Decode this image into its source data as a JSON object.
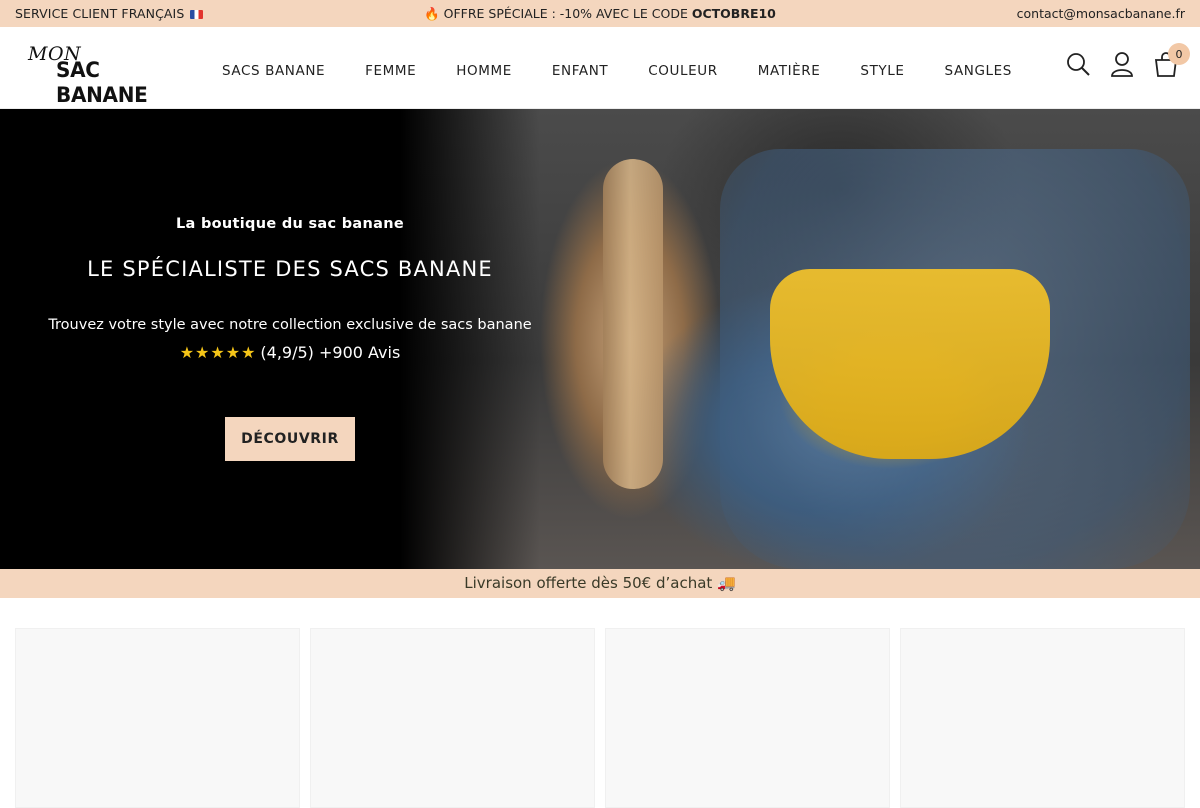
{
  "topbar": {
    "left_text": "SERVICE CLIENT FRANÇAIS",
    "flag_icon": "france-flag-icon",
    "offer_prefix": "🔥 OFFRE SPÉCIALE : -10% AVEC LE CODE ",
    "offer_code": "OCTOBRE10",
    "email": "contact@monsacbanane.fr"
  },
  "logo": {
    "top": "MON",
    "bottom": "SAC BANANE"
  },
  "nav": {
    "items": [
      "SACS BANANE",
      "FEMME",
      "HOMME",
      "ENFANT",
      "COULEUR",
      "MATIÈRE",
      "STYLE",
      "SANGLES"
    ]
  },
  "header_icons": {
    "search": "search-icon",
    "account": "user-icon",
    "cart": "cart-icon",
    "cart_count": "0"
  },
  "hero": {
    "kicker": "La boutique du sac banane",
    "title": "LE SPÉCIALISTE DES SACS BANANE",
    "description": "Trouvez votre style avec notre collection exclusive de sacs banane",
    "stars": "★★★★★",
    "rating": "(4,9/5) +900 Avis",
    "cta_label": "DÉCOUVRIR"
  },
  "shipping_banner": "Livraison offerte dès 50€ d’achat 🚚",
  "colors": {
    "accent": "#f4d6be",
    "star": "#f5c518",
    "hero_bg": "#000000"
  }
}
